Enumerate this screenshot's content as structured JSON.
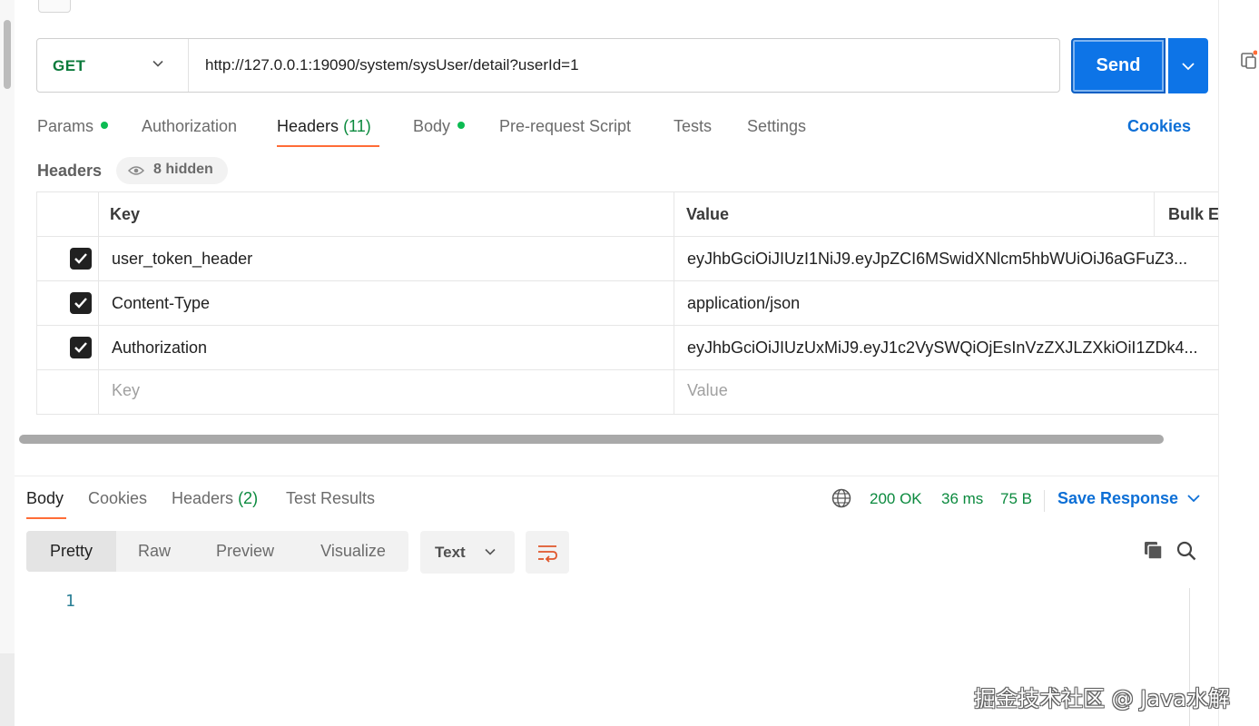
{
  "request": {
    "method": "GET",
    "url": "http://127.0.0.1:19090/system/sysUser/detail?userId=1",
    "send_label": "Send"
  },
  "request_tabs": {
    "params": "Params",
    "authorization": "Authorization",
    "headers": "Headers",
    "headers_count": "(11)",
    "body": "Body",
    "pre_request": "Pre-request Script",
    "tests": "Tests",
    "settings": "Settings",
    "cookies": "Cookies"
  },
  "headers_section": {
    "label": "Headers",
    "hidden_label": "8 hidden"
  },
  "headers_table": {
    "col_key": "Key",
    "col_value": "Value",
    "col_bulk": "Bulk Ed",
    "rows": [
      {
        "key": "user_token_header",
        "value": "eyJhbGciOiJIUzI1NiJ9.eyJpZCI6MSwidXNlcm5hbWUiOiJ6aGFuZ3...",
        "checked": true
      },
      {
        "key": "Content-Type",
        "value": "application/json",
        "checked": true
      },
      {
        "key": "Authorization",
        "value": "eyJhbGciOiJIUzUxMiJ9.eyJ1c2VySWQiOjEsInVzZXJLZXkiOiI1ZDk4...",
        "checked": true
      }
    ],
    "placeholder_key": "Key",
    "placeholder_value": "Value"
  },
  "response_tabs": {
    "body": "Body",
    "cookies": "Cookies",
    "headers": "Headers",
    "headers_count": "(2)",
    "test_results": "Test Results"
  },
  "response_status": {
    "code": "200 OK",
    "time": "36 ms",
    "size": "75 B",
    "save_response": "Save Response"
  },
  "body_view": {
    "modes": [
      "Pretty",
      "Raw",
      "Preview",
      "Visualize"
    ],
    "active_mode": "Pretty",
    "format": "Text",
    "line_numbers": [
      "1"
    ]
  },
  "watermark": "掘金技术社区 @ Java水解",
  "colors": {
    "send_blue": "#0d74e7",
    "method_green": "#0b7a3b",
    "status_green": "#0b8a3e",
    "accent_orange": "#ff6c37",
    "link_blue": "#0d6fd6"
  }
}
